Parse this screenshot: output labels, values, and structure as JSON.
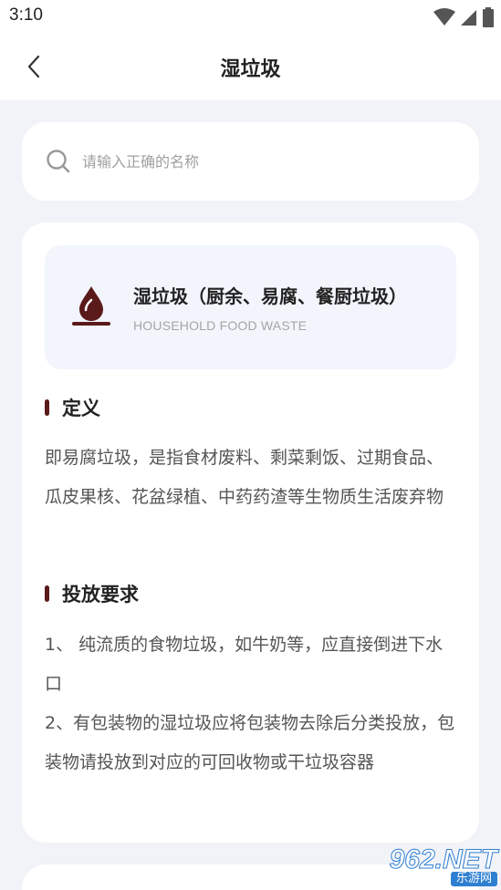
{
  "status_bar": {
    "time": "3:10",
    "icons": [
      "wifi-icon",
      "signal-icon",
      "battery-icon"
    ]
  },
  "header": {
    "title": "湿垃圾",
    "back_icon": "chevron-left-icon"
  },
  "search": {
    "placeholder": "请输入正确的名称",
    "value": "",
    "icon": "search-icon"
  },
  "category": {
    "icon": "water-drop-icon",
    "title": "湿垃圾（厨余、易腐、餐厨垃圾）",
    "subtitle": "HOUSEHOLD FOOD WASTE",
    "accent_color": "#5a1a1a"
  },
  "sections": {
    "definition": {
      "title": "定义",
      "body": "即易腐垃圾，是指食材废料、剩菜剩饭、过期食品、瓜皮果核、花盆绿植、中药药渣等生物质生活废弃物"
    },
    "disposal": {
      "title": "投放要求",
      "items": [
        "1、 纯流质的食物垃圾，如牛奶等，应直接倒进下水口",
        "2、有包装物的湿垃圾应将包装物去除后分类投放，包装物请投放到对应的可回收物或干垃圾容器"
      ]
    }
  },
  "watermark": {
    "brand": "962.NET",
    "sub": "乐游网"
  }
}
